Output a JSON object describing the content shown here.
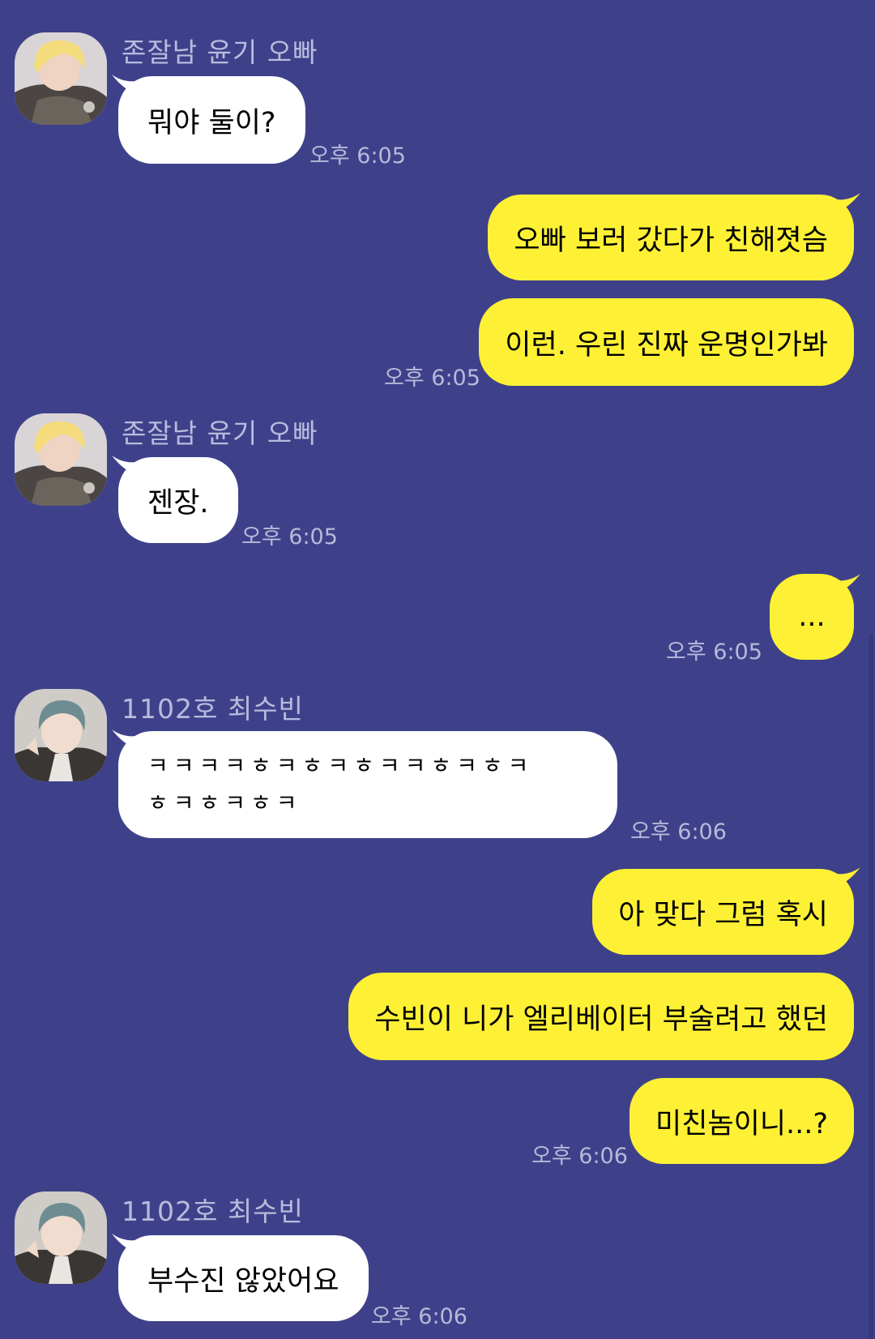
{
  "contacts": {
    "yoongi": {
      "name": "존잘남 윤기 오빠",
      "avatar": "yoongi-avatar"
    },
    "soobin": {
      "name": "1102호 최수빈",
      "avatar": "soobin-avatar"
    }
  },
  "messages": [
    {
      "sender": "yoongi",
      "text": "뭐야 둘이?",
      "time": "오후 6:05"
    },
    {
      "sender": "me",
      "text": "오빠 보러 갔다가 친해졋슴"
    },
    {
      "sender": "me",
      "text": "이런. 우린 진짜 운명인가봐",
      "time": "오후 6:05"
    },
    {
      "sender": "yoongi",
      "text": "젠장.",
      "time": "오후 6:05"
    },
    {
      "sender": "me",
      "text": "...",
      "time": "오후 6:05"
    },
    {
      "sender": "soobin",
      "line1": "ㅋㅋㅋㅋㅎㅋㅎㅋㅎㅋㅋㅎㅋㅎㅋ",
      "line2": "ㅎㅋㅎㅋㅎㅋ",
      "time": "오후 6:06"
    },
    {
      "sender": "me",
      "text": "아 맞다 그럼 혹시"
    },
    {
      "sender": "me",
      "text": "수빈이 니가 엘리베이터 부술려고 했던"
    },
    {
      "sender": "me",
      "text": "미친놈이니...?",
      "time": "오후 6:06"
    },
    {
      "sender": "soobin",
      "text": "부수진 않았어요",
      "time": "오후 6:06"
    }
  ],
  "colors": {
    "background": "#3e418a",
    "incoming_bubble": "#ffffff",
    "outgoing_bubble": "#fef135",
    "meta_text": "#b7b9d9"
  }
}
